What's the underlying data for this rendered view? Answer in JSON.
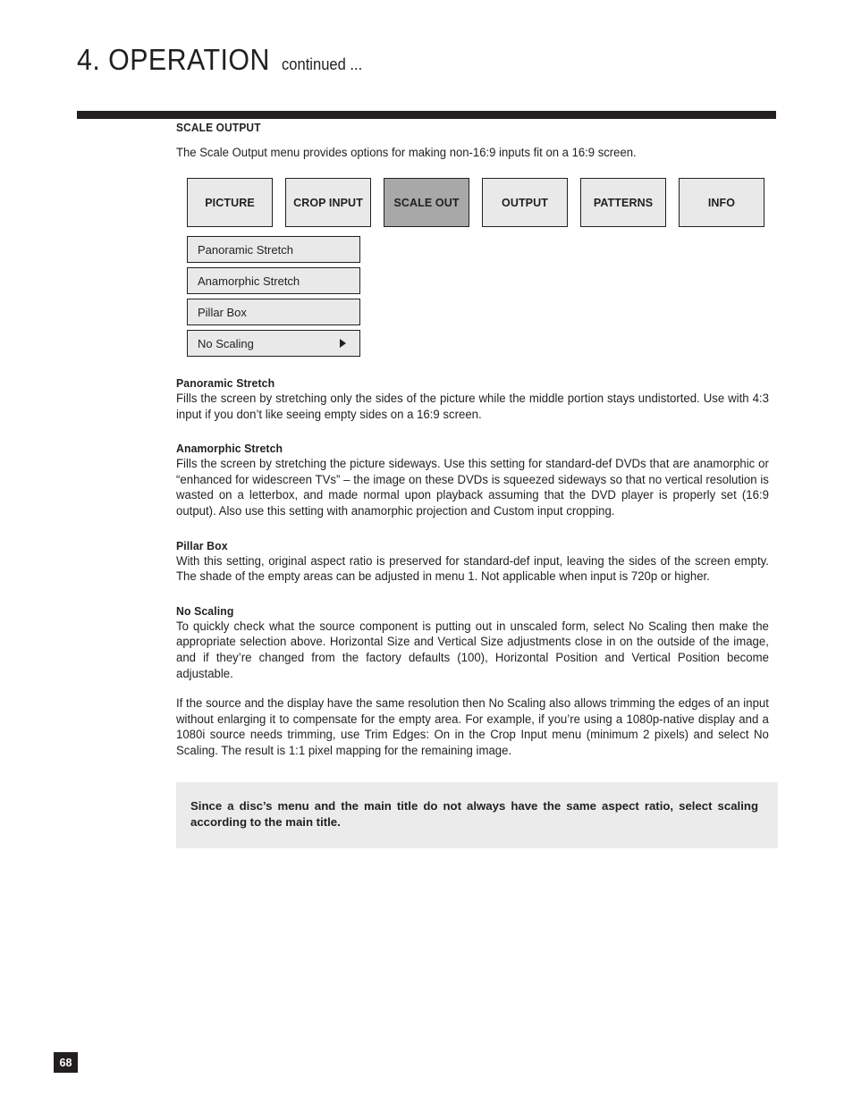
{
  "header": {
    "chapter": "4. OPERATION",
    "continued": "continued ..."
  },
  "section": {
    "title": "SCALE OUTPUT",
    "intro": "The Scale Output menu provides options for making non-16:9 inputs fit on a 16:9 screen."
  },
  "menu_tabs": [
    {
      "label": "PICTURE",
      "selected": false
    },
    {
      "label": "CROP INPUT",
      "selected": false
    },
    {
      "label": "SCALE OUT",
      "selected": true
    },
    {
      "label": "OUTPUT",
      "selected": false
    },
    {
      "label": "PATTERNS",
      "selected": false
    },
    {
      "label": "INFO",
      "selected": false
    }
  ],
  "submenu": [
    {
      "label": "Panoramic Stretch",
      "arrow": false
    },
    {
      "label": "Anamorphic Stretch",
      "arrow": false
    },
    {
      "label": "Pillar Box",
      "arrow": false
    },
    {
      "label": "No Scaling",
      "arrow": true
    }
  ],
  "blocks": [
    {
      "heading": "Panoramic Stretch",
      "paragraphs": [
        "Fills the screen by stretching only the sides of the picture while the middle portion stays undistorted. Use with 4:3 input if you don’t like seeing empty sides on a 16:9 screen."
      ]
    },
    {
      "heading": "Anamorphic Stretch",
      "paragraphs": [
        "Fills the screen by stretching the picture sideways. Use this setting for standard-def DVDs that are anamorphic or “enhanced for widescreen TVs” – the image on these DVDs is squeezed sideways so that no vertical resolution is wasted on a letterbox, and made normal upon playback assuming that the DVD player is properly set (16:9 output). Also use this setting with anamorphic projection and Custom input cropping."
      ]
    },
    {
      "heading": "Pillar Box",
      "paragraphs": [
        "With this setting, original aspect ratio is preserved for standard-def input, leaving the sides of the screen empty. The shade of the empty areas can be adjusted in menu 1. Not applicable when input is 720p or higher."
      ]
    },
    {
      "heading": "No Scaling",
      "paragraphs": [
        "To quickly check what the source component is putting out in unscaled form, select No Scaling then make the appropriate selection above. Horizontal Size and Vertical Size adjustments close in on the outside of the image, and if they’re changed from the factory defaults (100), Horizontal Position and Vertical Position become adjustable.",
        "If the source and the display have the same resolution then No Scaling also allows trimming the edges of an input without enlarging it to compensate for the empty area. For example, if you’re using a 1080p-native display and a 1080i source needs trimming, use Trim Edges: On in the Crop Input menu (minimum 2 pixels) and select No Scaling. The result is 1:1 pixel mapping for the remaining image."
      ]
    }
  ],
  "callout": {
    "text": "Since a disc’s menu and the main title do not always have the same aspect ratio, select scaling according to the main title."
  },
  "folio": {
    "page_number": "68"
  },
  "colors": {
    "ink": "#231f20",
    "button_fill": "#e9e9e9",
    "button_selected_fill": "#a8a8a8",
    "callout_fill": "#ebebeb"
  }
}
